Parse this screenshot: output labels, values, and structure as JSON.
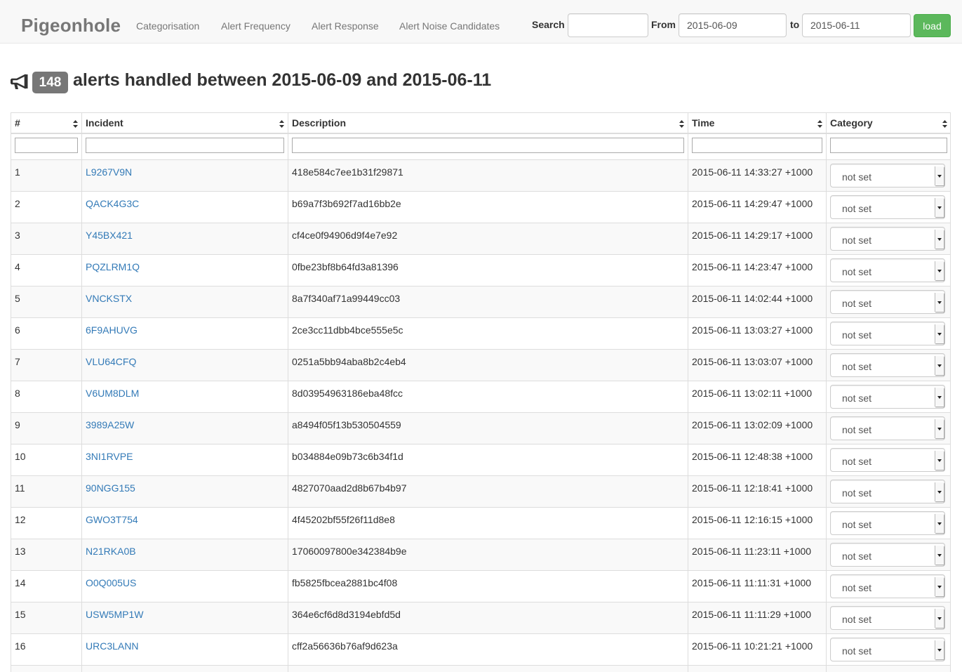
{
  "navbar": {
    "brand": "Pigeonhole",
    "links": [
      "Categorisation",
      "Alert Frequency",
      "Alert Response",
      "Alert Noise Candidates"
    ],
    "search_label": "Search",
    "search_value": "",
    "from_label": "From",
    "from_value": "2015-06-09",
    "to_label": "to",
    "to_value": "2015-06-11",
    "load_label": "load"
  },
  "heading": {
    "icon": "megaphone-icon",
    "count": "148",
    "title": "alerts handled between 2015-06-09 and 2015-06-11"
  },
  "table": {
    "columns": [
      "#",
      "Incident",
      "Description",
      "Time",
      "Category"
    ],
    "rows": [
      {
        "num": "1",
        "incident": "L9267V9N",
        "description": "418e584c7ee1b31f29871",
        "time": "2015-06-11 14:33:27 +1000",
        "category": "not set"
      },
      {
        "num": "2",
        "incident": "QACK4G3C",
        "description": "b69a7f3b692f7ad16bb2e",
        "time": "2015-06-11 14:29:47 +1000",
        "category": "not set"
      },
      {
        "num": "3",
        "incident": "Y45BX421",
        "description": "cf4ce0f94906d9f4e7e92",
        "time": "2015-06-11 14:29:17 +1000",
        "category": "not set"
      },
      {
        "num": "4",
        "incident": "PQZLRM1Q",
        "description": "0fbe23bf8b64fd3a81396",
        "time": "2015-06-11 14:23:47 +1000",
        "category": "not set"
      },
      {
        "num": "5",
        "incident": "VNCKSTX",
        "description": "8a7f340af71a99449cc03",
        "time": "2015-06-11 14:02:44 +1000",
        "category": "not set"
      },
      {
        "num": "6",
        "incident": "6F9AHUVG",
        "description": "2ce3cc11dbb4bce555e5c",
        "time": "2015-06-11 13:03:27 +1000",
        "category": "not set"
      },
      {
        "num": "7",
        "incident": "VLU64CFQ",
        "description": "0251a5bb94aba8b2c4eb4",
        "time": "2015-06-11 13:03:07 +1000",
        "category": "not set"
      },
      {
        "num": "8",
        "incident": "V6UM8DLM",
        "description": "8d03954963186eba48fcc",
        "time": "2015-06-11 13:02:11 +1000",
        "category": "not set"
      },
      {
        "num": "9",
        "incident": "3989A25W",
        "description": "a8494f05f13b530504559",
        "time": "2015-06-11 13:02:09 +1000",
        "category": "not set"
      },
      {
        "num": "10",
        "incident": "3NI1RVPE",
        "description": "b034884e09b73c6b34f1d",
        "time": "2015-06-11 12:48:38 +1000",
        "category": "not set"
      },
      {
        "num": "11",
        "incident": "90NGG155",
        "description": "4827070aad2d8b67b4b97",
        "time": "2015-06-11 12:18:41 +1000",
        "category": "not set"
      },
      {
        "num": "12",
        "incident": "GWO3T754",
        "description": "4f45202bf55f26f11d8e8",
        "time": "2015-06-11 12:16:15 +1000",
        "category": "not set"
      },
      {
        "num": "13",
        "incident": "N21RKA0B",
        "description": "17060097800e342384b9e",
        "time": "2015-06-11 11:23:11 +1000",
        "category": "not set"
      },
      {
        "num": "14",
        "incident": "O0Q005US",
        "description": "fb5825fbcea2881bc4f08",
        "time": "2015-06-11 11:11:31 +1000",
        "category": "not set"
      },
      {
        "num": "15",
        "incident": "USW5MP1W",
        "description": "364e6cf6d8d3194ebfd5d",
        "time": "2015-06-11 11:11:29 +1000",
        "category": "not set"
      },
      {
        "num": "16",
        "incident": "URC3LANN",
        "description": "cff2a56636b76af9d623a",
        "time": "2015-06-11 10:21:21 +1000",
        "category": "not set"
      },
      {
        "num": "",
        "incident": "",
        "description": "",
        "time": "",
        "category": ""
      }
    ]
  },
  "colors": {
    "link": "#337ab7",
    "badge": "#777777",
    "load_button": "#5cb85c",
    "navbar_bg": "#f8f8f8"
  }
}
